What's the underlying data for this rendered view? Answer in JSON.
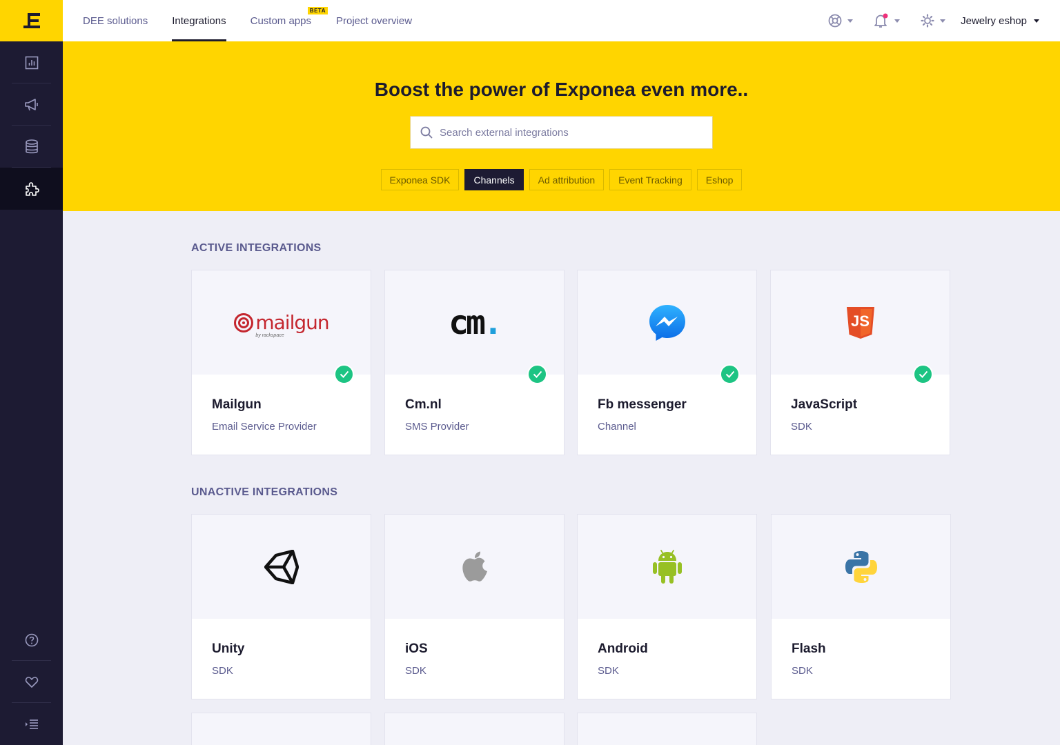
{
  "nav": {
    "tabs": [
      "DEE solutions",
      "Integrations",
      "Custom apps",
      "Project overview"
    ],
    "beta_badge": "BETA",
    "project": "Jewelry eshop"
  },
  "hero": {
    "title": "Boost the power of Exponea even more..",
    "search_placeholder": "Search external integrations",
    "chips": [
      "Exponea SDK",
      "Channels",
      "Ad attribution",
      "Event Tracking",
      "Eshop"
    ],
    "active_chip": "Channels"
  },
  "sections": {
    "active_title": "ACTIVE INTEGRATIONS",
    "inactive_title": "UNACTIVE INTEGRATIONS"
  },
  "active": [
    {
      "name": "Mailgun",
      "type": "Email Service Provider",
      "logo": "mailgun-logo",
      "logo_text": "mailgun",
      "logo_sub": "by rackspace"
    },
    {
      "name": "Cm.nl",
      "type": "SMS Provider",
      "logo": "cm-logo",
      "logo_text": "cm",
      "logo_dot": "."
    },
    {
      "name": "Fb messenger",
      "type": "Channel",
      "logo": "messenger-logo"
    },
    {
      "name": "JavaScript",
      "type": "SDK",
      "logo": "js-logo",
      "logo_text": "JS"
    }
  ],
  "inactive": [
    {
      "name": "Unity",
      "type": "SDK",
      "logo": "unity-logo"
    },
    {
      "name": "iOS",
      "type": "SDK",
      "logo": "apple-logo"
    },
    {
      "name": "Android",
      "type": "SDK",
      "logo": "android-logo"
    },
    {
      "name": "Flash",
      "type": "SDK",
      "logo": "python-logo"
    }
  ],
  "colors": {
    "brand_yellow": "#FFD500",
    "sidebar": "#1D1B33",
    "active_check": "#1DC483",
    "notification_dot": "#F0307A"
  }
}
